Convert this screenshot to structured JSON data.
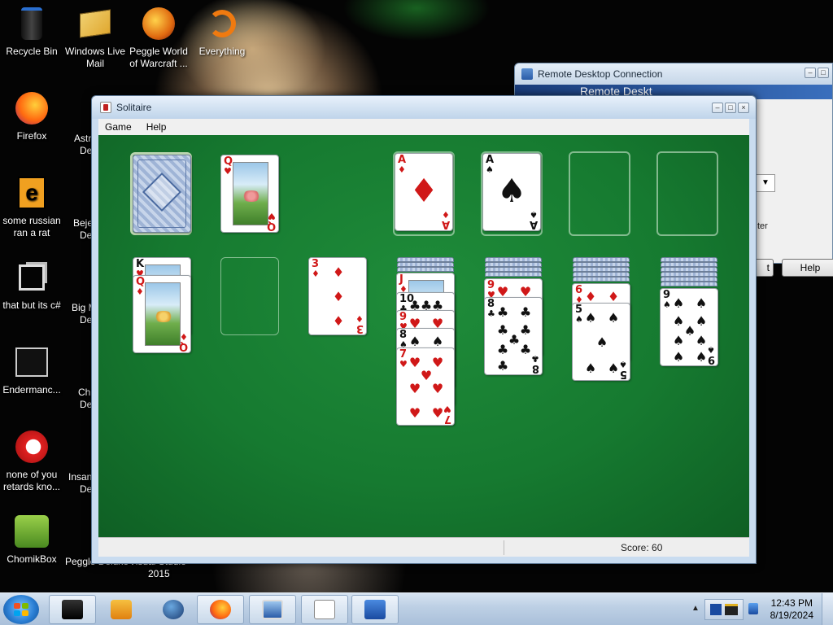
{
  "desktop": {
    "icons": [
      {
        "id": "recycle-bin",
        "label": "Recycle Bin",
        "icon": "recycle-bin-icon"
      },
      {
        "id": "windows-live-mail",
        "label": "Windows Live Mail",
        "icon": "mail-icon"
      },
      {
        "id": "peggle-world-of-warcraft",
        "label": "Peggle World of Warcraft ...",
        "icon": "peggle-icon"
      },
      {
        "id": "everything",
        "label": "Everything",
        "icon": "search-icon"
      },
      {
        "id": "firefox",
        "label": "Firefox",
        "icon": "firefox-icon"
      },
      {
        "id": "some-russian",
        "label": "some russian ran a rat",
        "icon": "file-icon"
      },
      {
        "id": "that-but-its-csharp",
        "label": "that but its c#",
        "icon": "shortcut-icon"
      },
      {
        "id": "endermanc",
        "label": "Endermanc...",
        "icon": "app-icon"
      },
      {
        "id": "none-of-you",
        "label": "none of you retards kno...",
        "icon": "browser-icon"
      },
      {
        "id": "chomikbox",
        "label": "ChomikBox",
        "icon": "chomikbox-icon"
      }
    ],
    "partial_labels": [
      "Astr",
      "De",
      "Beje",
      "De",
      "Big M",
      "De",
      "Ch",
      "De",
      "Insan",
      "De",
      "Peggle Deluxe",
      "Visual Studio",
      "2015"
    ]
  },
  "remote_desktop": {
    "title": "Remote Desktop Connection",
    "banner_text": "Remote Deskt",
    "partial_text": "ter",
    "button_partial": "t",
    "help_button": "Help"
  },
  "solitaire": {
    "title": "Solitaire",
    "menu": [
      "Game",
      "Help"
    ],
    "score_label": "Score: 60",
    "waste": {
      "rank": "Q",
      "suit": "♥",
      "color": "red"
    },
    "foundations": [
      {
        "rank": "A",
        "suit": "♦",
        "color": "red"
      },
      {
        "rank": "A",
        "suit": "♠",
        "color": "black"
      },
      null,
      null
    ],
    "tableau": [
      {
        "face_down": 0,
        "cards": [
          {
            "rank": "K",
            "suit": "♥",
            "color": "red"
          },
          {
            "rank": "Q",
            "suit": "♦",
            "color": "red"
          }
        ]
      },
      {
        "face_down": 0,
        "cards": []
      },
      {
        "face_down": 0,
        "cards": [
          {
            "rank": "3",
            "suit": "♦",
            "color": "red"
          }
        ]
      },
      {
        "face_down": 3,
        "cards": [
          {
            "rank": "J",
            "suit": "♦",
            "color": "red"
          },
          {
            "rank": "10",
            "suit": "♣",
            "color": "black"
          },
          {
            "rank": "9",
            "suit": "♥",
            "color": "red"
          },
          {
            "rank": "8",
            "suit": "♠",
            "color": "black"
          },
          {
            "rank": "7",
            "suit": "♥",
            "color": "red"
          }
        ]
      },
      {
        "face_down": 4,
        "cards": [
          {
            "rank": "9",
            "suit": "♥",
            "color": "red"
          },
          {
            "rank": "8",
            "suit": "♣",
            "color": "black"
          }
        ]
      },
      {
        "face_down": 5,
        "cards": [
          {
            "rank": "6",
            "suit": "♦",
            "color": "red"
          },
          {
            "rank": "5",
            "suit": "♠",
            "color": "black"
          }
        ]
      },
      {
        "face_down": 6,
        "cards": [
          {
            "rank": "9",
            "suit": "♠",
            "color": "black"
          }
        ]
      }
    ]
  },
  "taskbar": {
    "items": [
      {
        "name": "taskbar-item-1",
        "icon": "black-box-icon"
      },
      {
        "name": "taskbar-item-2",
        "icon": "media-player-icon"
      },
      {
        "name": "taskbar-item-3",
        "icon": "globe-icon"
      },
      {
        "name": "taskbar-item-firefox",
        "icon": "firefox-icon"
      },
      {
        "name": "taskbar-item-remote-desktop",
        "icon": "remote-desktop-icon"
      },
      {
        "name": "taskbar-item-solitaire",
        "icon": "solitaire-icon"
      },
      {
        "name": "taskbar-item-network",
        "icon": "network-icon"
      }
    ],
    "clock_time": "12:43 PM",
    "clock_date": "8/19/2024"
  }
}
